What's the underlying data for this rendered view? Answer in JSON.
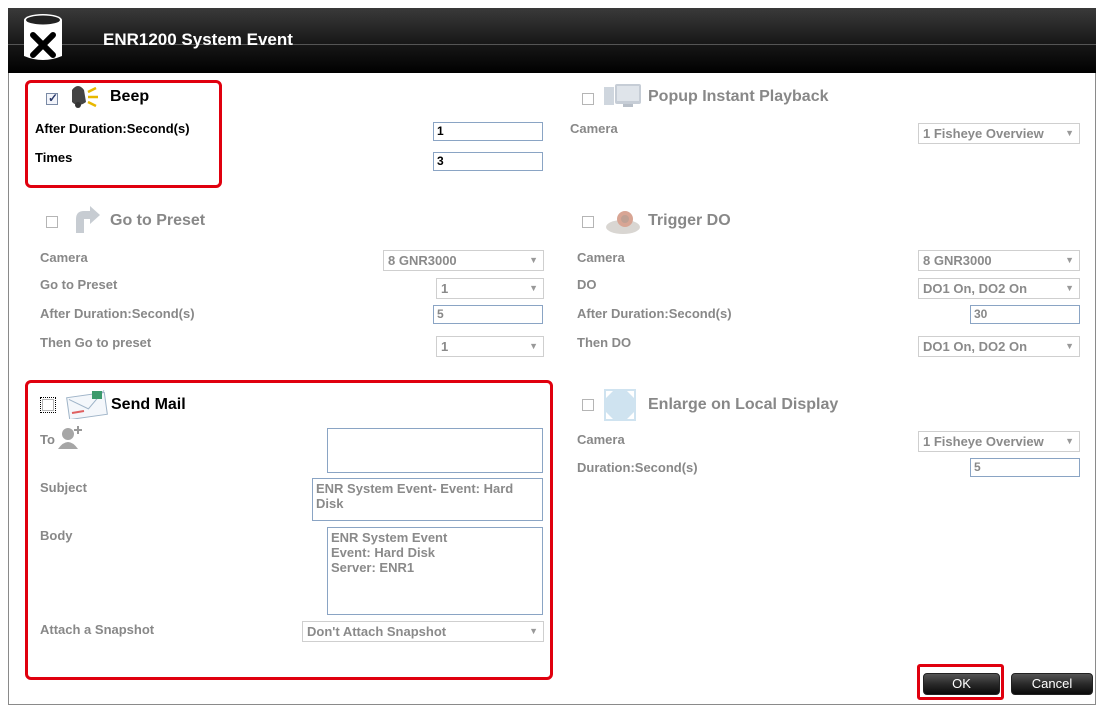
{
  "window": {
    "title": "ENR1200 System Event"
  },
  "beep": {
    "label": "Beep",
    "checked": true,
    "after_duration_label": "After Duration:Second(s)",
    "after_duration_value": "1",
    "times_label": "Times",
    "times_value": "3"
  },
  "popup": {
    "label": "Popup Instant Playback",
    "camera_label": "Camera",
    "camera_value": "1 Fisheye Overview"
  },
  "preset": {
    "label": "Go to Preset",
    "camera_label": "Camera",
    "camera_value": "8 GNR3000",
    "goto_label": "Go to Preset",
    "goto_value": "1",
    "after_duration_label": "After Duration:Second(s)",
    "after_duration_value": "5",
    "then_label": "Then Go to preset",
    "then_value": "1"
  },
  "trigger": {
    "label": "Trigger DO",
    "camera_label": "Camera",
    "camera_value": "8 GNR3000",
    "do_label": "DO",
    "do_value": "DO1 On, DO2 On",
    "after_duration_label": "After Duration:Second(s)",
    "after_duration_value": "30",
    "then_label": "Then DO",
    "then_value": "DO1 On, DO2 On"
  },
  "mail": {
    "label": "Send Mail",
    "to_label": "To",
    "to_value": "",
    "subject_label": "Subject",
    "subject_value": "ENR System Event- Event: Hard Disk",
    "body_label": "Body",
    "body_value": "ENR System Event\nEvent: Hard Disk\nServer: ENR1",
    "snapshot_label": "Attach a Snapshot",
    "snapshot_value": "Don't Attach Snapshot"
  },
  "enlarge": {
    "label": "Enlarge on Local Display",
    "camera_label": "Camera",
    "camera_value": "1 Fisheye Overview",
    "duration_label": "Duration:Second(s)",
    "duration_value": "5"
  },
  "buttons": {
    "ok": "OK",
    "cancel": "Cancel"
  },
  "icons": {
    "title": "close-x-icon",
    "beep": "bell-icon",
    "popup": "monitor-icon",
    "preset": "arrow-icon",
    "trigger": "do-device-icon",
    "mail": "envelope-icon",
    "to": "add-contact-icon",
    "enlarge": "enlarge-icon"
  },
  "colors": {
    "highlight": "#e0000e",
    "titlebar": "#1a1a1a"
  }
}
